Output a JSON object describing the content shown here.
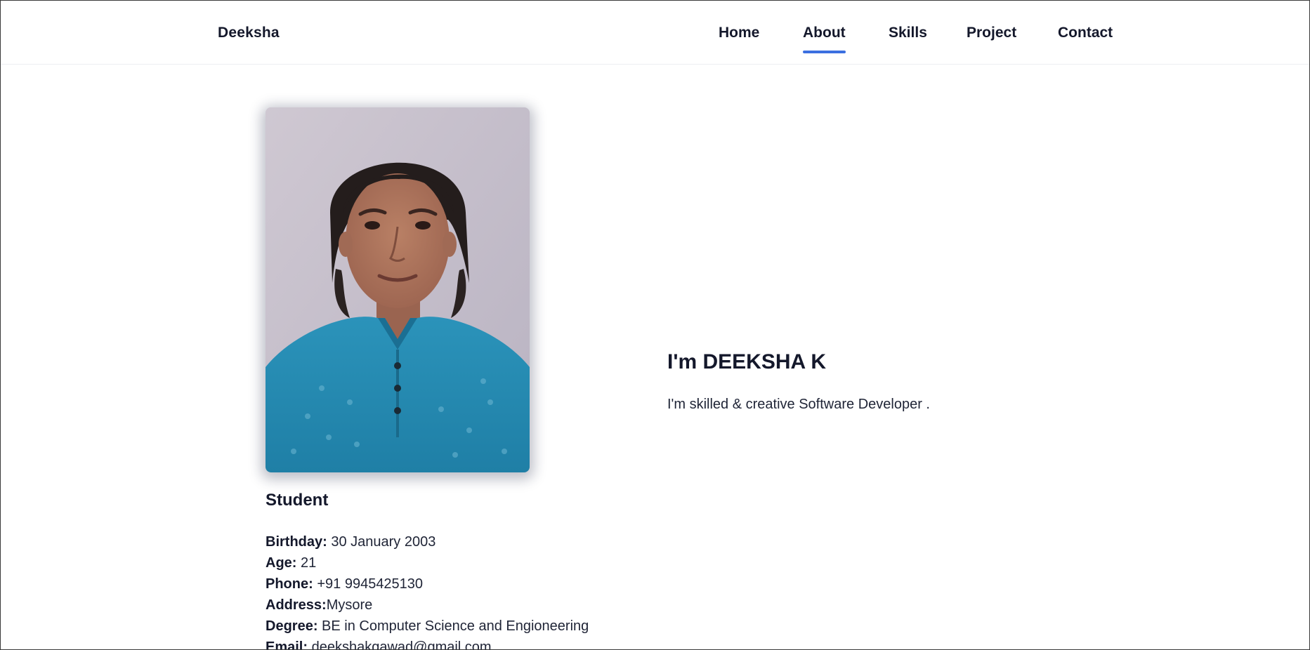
{
  "header": {
    "brand": "Deeksha",
    "nav": {
      "home": "Home",
      "about": "About",
      "skills": "Skills",
      "project": "Project",
      "contact": "Contact",
      "active": "About"
    }
  },
  "profile": {
    "role": "Student",
    "details": {
      "birthday_label": "Birthday:",
      "birthday_value": " 30 January 2003",
      "age_label": "Age:",
      "age_value": " 21",
      "phone_label": "Phone:",
      "phone_value": " +91 9945425130",
      "address_label": "Address:",
      "address_value": "Mysore",
      "degree_label": "Degree:",
      "degree_value": " BE in Computer Science and Engioneering",
      "email_label": "Email:",
      "email_value": " deekshakgawad@gmail.com"
    }
  },
  "intro": {
    "title": "I'm DEEKSHA K",
    "text": "I'm skilled & creative Software Developer ."
  },
  "colors": {
    "text": "#14182b",
    "accent": "#3b6fe0",
    "background": "#ffffff"
  }
}
